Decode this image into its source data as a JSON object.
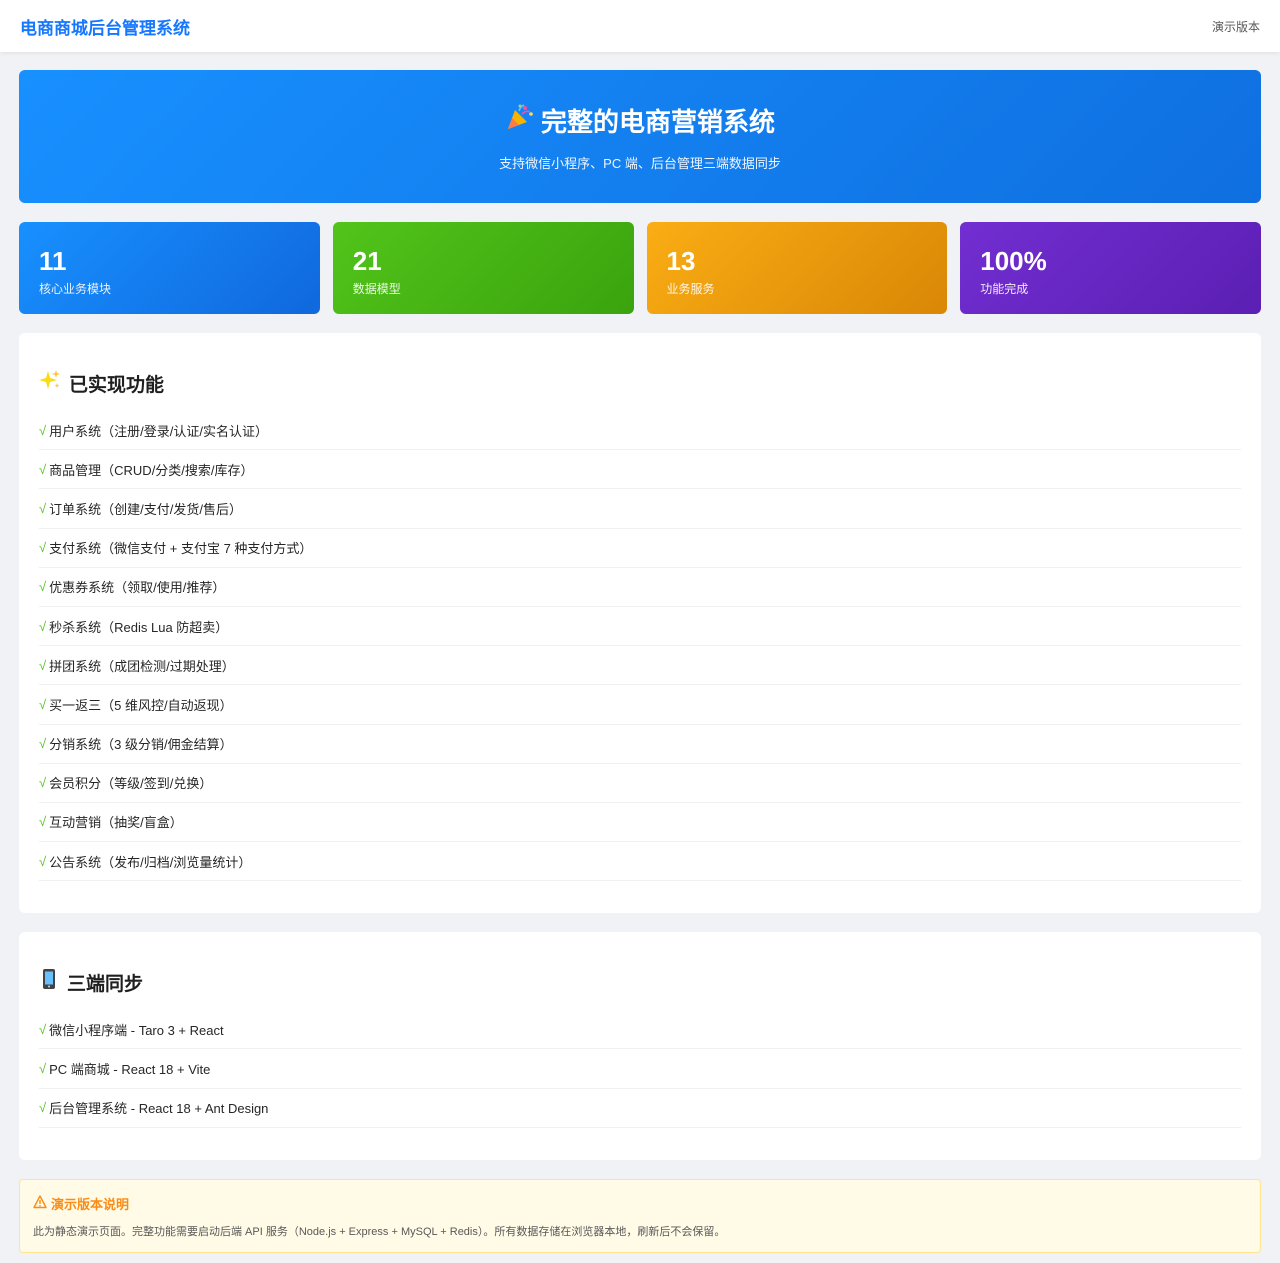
{
  "header": {
    "brand": "电商商城后台管理系统",
    "version_label": "演示版本"
  },
  "hero": {
    "icon": "party-popper-icon",
    "title": "完整的电商营销系统",
    "subtitle": "支持微信小程序、PC 端、后台管理三端数据同步"
  },
  "stats": [
    {
      "value": "11",
      "label": "核心业务模块",
      "color": "#1890ff"
    },
    {
      "value": "21",
      "label": "数据模型",
      "color": "#52c41a"
    },
    {
      "value": "13",
      "label": "业务服务",
      "color": "#faad14"
    },
    {
      "value": "100%",
      "label": "功能完成",
      "color": "#722ed1"
    }
  ],
  "features": {
    "icon": "sparkles-icon",
    "title": "已实现功能",
    "items": [
      "用户系统（注册/登录/认证/实名认证）",
      "商品管理（CRUD/分类/搜索/库存）",
      "订单系统（创建/支付/发货/售后）",
      "支付系统（微信支付 + 支付宝 7 种支付方式）",
      "优惠券系统（领取/使用/推荐）",
      "秒杀系统（Redis Lua 防超卖）",
      "拼团系统（成团检测/过期处理）",
      "买一返三（5 维风控/自动返现）",
      "分销系统（3 级分销/佣金结算）",
      "会员积分（等级/签到/兑换）",
      "互动营销（抽奖/盲盒）",
      "公告系统（发布/归档/浏览量统计）"
    ]
  },
  "sync": {
    "icon": "mobile-phone-icon",
    "title": "三端同步",
    "items": [
      "微信小程序端 - Taro 3 + React",
      "PC 端商城 - React 18 + Vite",
      "后台管理系统 - React 18 + Ant Design"
    ]
  },
  "check_mark": "√",
  "notice": {
    "icon": "warning-icon",
    "title": "演示版本说明",
    "text": "此为静态演示页面。完整功能需要启动后端 API 服务（Node.js + Express + MySQL + Redis）。所有数据存储在浏览器本地，刷新后不会保留。"
  },
  "colors": {
    "primary": "#1677ff",
    "success": "#52c41a",
    "warning": "#fa8c16"
  }
}
